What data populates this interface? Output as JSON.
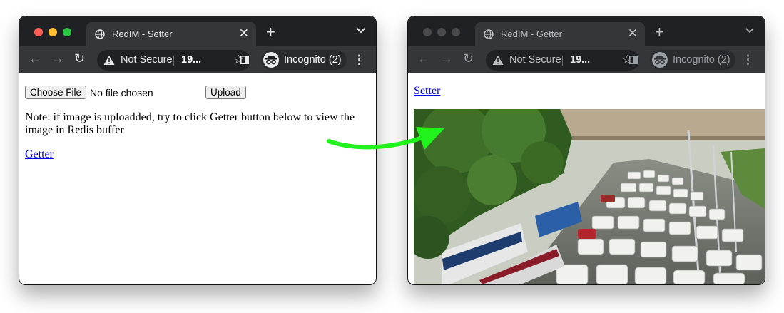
{
  "left_window": {
    "tab_title": "RedIM - Setter",
    "address": {
      "security_label": "Not Secure",
      "host": "19..."
    },
    "profile_label": "Incognito (2)",
    "page": {
      "choose_file_label": "Choose File",
      "file_status": "No file chosen",
      "upload_label": "Upload",
      "note": "Note: if image is uploadded, try to click Getter button below to view the image in Redis buffer",
      "getter_link": "Getter"
    }
  },
  "right_window": {
    "tab_title": "RedIM - Getter",
    "address": {
      "security_label": "Not Secure",
      "host": "19..."
    },
    "profile_label": "Incognito (2)",
    "page": {
      "setter_link": "Setter",
      "image_description": "traffic-jam-photo"
    }
  },
  "colors": {
    "titlebar": "#202124",
    "toolbar": "#35363a",
    "close_dot": "#ff5f57",
    "minimize_dot": "#febc2e",
    "zoom_dot": "#28c840",
    "inactive_dot": "#4a4a4d",
    "link": "#0000ee",
    "arrow": "#21f21b"
  }
}
